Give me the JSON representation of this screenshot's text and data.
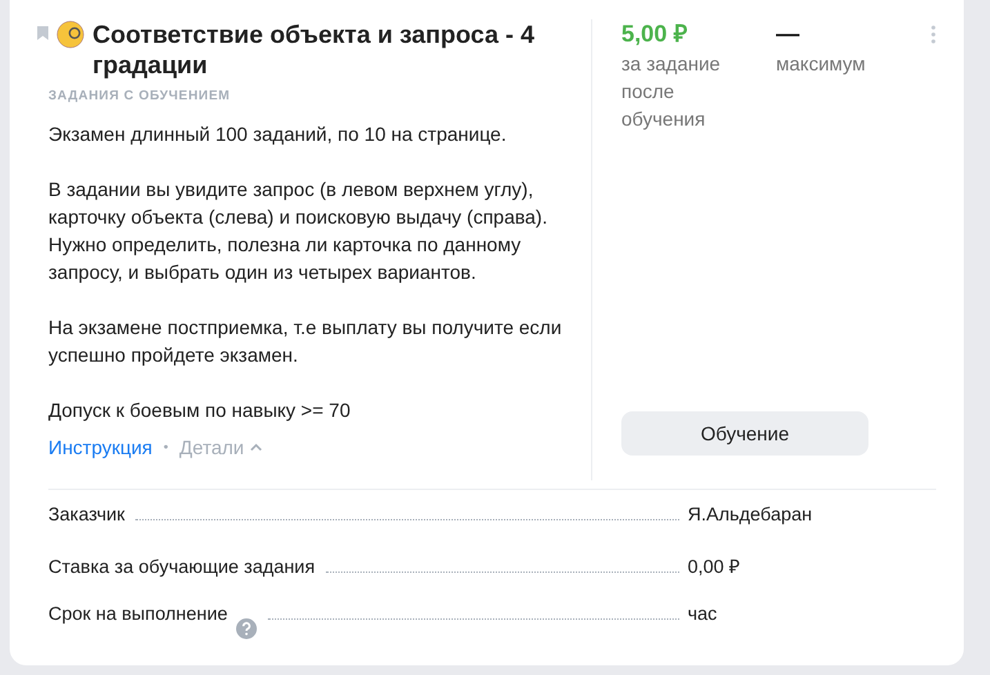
{
  "task": {
    "bookmarked": false,
    "title": "Соответствие объекта и запроса - 4 градации",
    "category": "ЗАДАНИЯ С ОБУЧЕНИЕМ",
    "description": [
      "Экзамен длинный 100 заданий, по 10 на странице.",
      "В задании вы увидите запрос (в левом верхнем углу),\nкарточку объекта (слева) и поисковую выдачу (справа).\nНужно определить, полезна ли карточка по данному\nзапросу, и выбрать один из четырех вариантов.",
      "На экзамене постприемка, т.е выплату вы получите если\nуспешно пройдете экзамен.",
      "Допуск к боевым по навыку >= 70"
    ],
    "links": {
      "instruction": "Инструкция",
      "separator": "•",
      "details": "Детали",
      "details_expanded": true
    },
    "price": {
      "value": "5,00 ₽",
      "caption": "за задание\nпосле\nобучения"
    },
    "maximum": {
      "value": "—",
      "caption": "максимум"
    },
    "action_button": "Обучение",
    "info": [
      {
        "label": "Заказчик",
        "value": "Я.Альдебаран",
        "help": false
      },
      {
        "label": "Ставка за обучающие задания",
        "value": "0,00 ₽",
        "help": false
      },
      {
        "label": "Срок на выполнение",
        "value": "час",
        "help": true
      }
    ]
  }
}
